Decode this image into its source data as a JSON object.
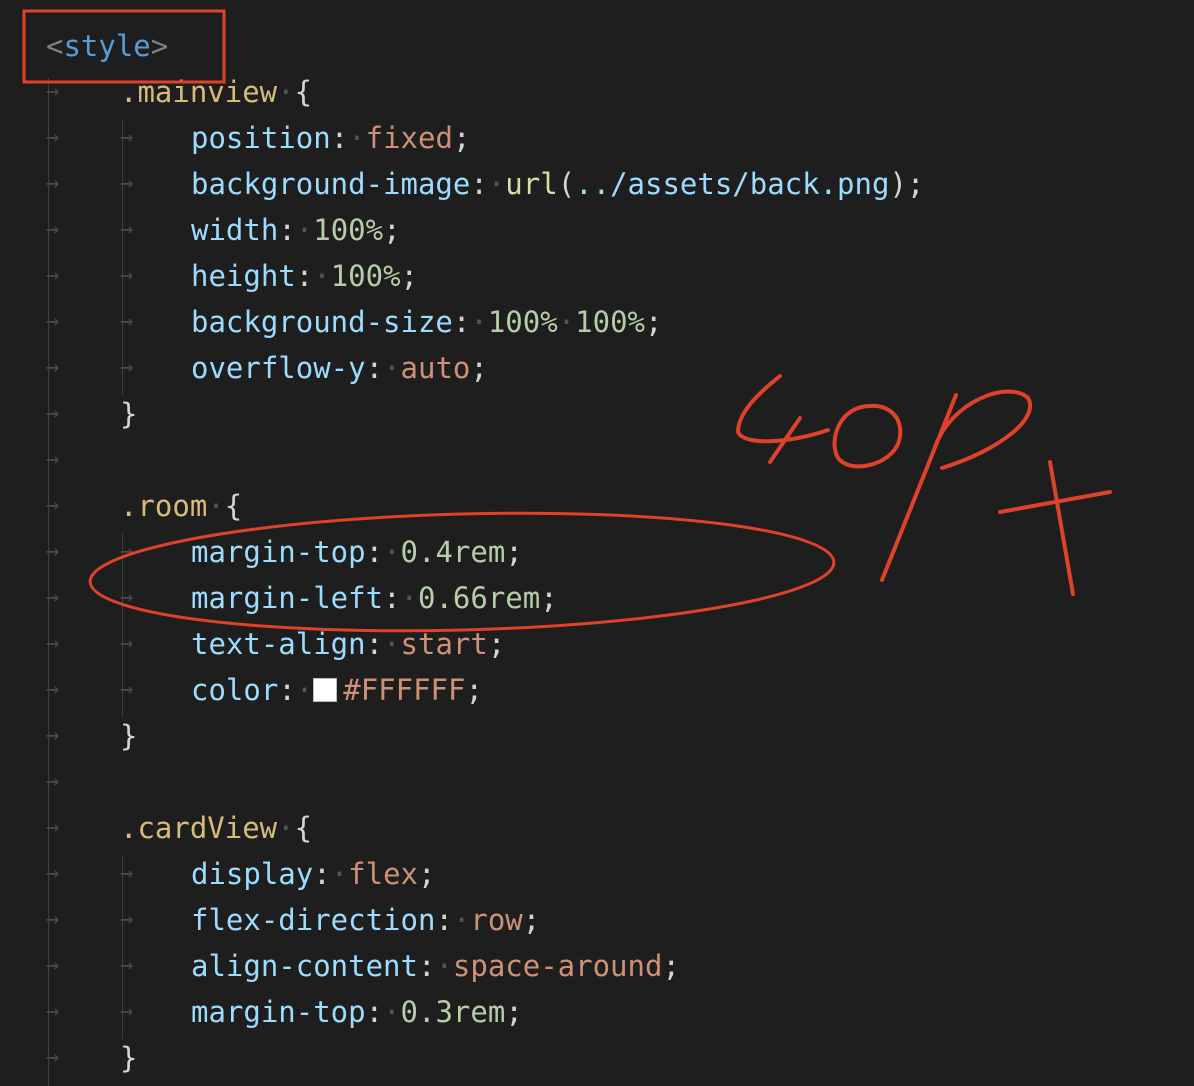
{
  "editor": {
    "theme_colors": {
      "background": "#1e1e1e",
      "tag": "#569cd6",
      "selector": "#d7ba7d",
      "property": "#9cdcfe",
      "keyword_value": "#ce9178",
      "number": "#b5cea8",
      "function": "#dcdcaa",
      "annotation": "#e0412a"
    },
    "lines": [
      {
        "type": "tag",
        "open": "<",
        "name": "style",
        "close": ">"
      },
      {
        "type": "selector",
        "selector": ".mainview",
        "brace": "{"
      },
      {
        "type": "decl",
        "property": "position",
        "colon": ":",
        "parts": [
          {
            "kind": "val",
            "text": "fixed"
          }
        ],
        "semi": ";"
      },
      {
        "type": "decl",
        "property": "background-image",
        "colon": ":",
        "parts": [
          {
            "kind": "fn",
            "text": "url"
          },
          {
            "kind": "plain",
            "text": "("
          },
          {
            "kind": "prop",
            "text": "../assets/back.png"
          },
          {
            "kind": "plain",
            "text": ")"
          }
        ],
        "semi": ";"
      },
      {
        "type": "decl",
        "property": "width",
        "colon": ":",
        "parts": [
          {
            "kind": "num",
            "text": "100%"
          }
        ],
        "semi": ";"
      },
      {
        "type": "decl",
        "property": "height",
        "colon": ":",
        "parts": [
          {
            "kind": "num",
            "text": "100%"
          }
        ],
        "semi": ";"
      },
      {
        "type": "decl",
        "property": "background-size",
        "colon": ":",
        "parts": [
          {
            "kind": "num",
            "text": "100%"
          },
          {
            "kind": "num",
            "text": "100%"
          }
        ],
        "semi": ";"
      },
      {
        "type": "decl",
        "property": "overflow-y",
        "colon": ":",
        "parts": [
          {
            "kind": "val",
            "text": "auto"
          }
        ],
        "semi": ";"
      },
      {
        "type": "close",
        "brace": "}"
      },
      {
        "type": "blank"
      },
      {
        "type": "selector",
        "selector": ".room",
        "brace": "{"
      },
      {
        "type": "decl",
        "property": "margin-top",
        "colon": ":",
        "parts": [
          {
            "kind": "num",
            "text": "0.4rem"
          }
        ],
        "semi": ";"
      },
      {
        "type": "decl",
        "property": "margin-left",
        "colon": ":",
        "parts": [
          {
            "kind": "num",
            "text": "0.66rem"
          }
        ],
        "semi": ";"
      },
      {
        "type": "decl",
        "property": "text-align",
        "colon": ":",
        "parts": [
          {
            "kind": "val",
            "text": "start"
          }
        ],
        "semi": ";"
      },
      {
        "type": "decl",
        "property": "color",
        "colon": ":",
        "parts": [
          {
            "kind": "swatch",
            "color": "#FFFFFF"
          },
          {
            "kind": "val",
            "text": "#FFFFFF"
          }
        ],
        "semi": ";"
      },
      {
        "type": "close",
        "brace": "}"
      },
      {
        "type": "blank"
      },
      {
        "type": "selector",
        "selector": ".cardView",
        "brace": "{"
      },
      {
        "type": "decl",
        "property": "display",
        "colon": ":",
        "parts": [
          {
            "kind": "val",
            "text": "flex"
          }
        ],
        "semi": ";"
      },
      {
        "type": "decl",
        "property": "flex-direction",
        "colon": ":",
        "parts": [
          {
            "kind": "val",
            "text": "row"
          }
        ],
        "semi": ";"
      },
      {
        "type": "decl",
        "property": "align-content",
        "colon": ":",
        "parts": [
          {
            "kind": "val",
            "text": "space-around"
          }
        ],
        "semi": ";"
      },
      {
        "type": "decl",
        "property": "margin-top",
        "colon": ":",
        "parts": [
          {
            "kind": "num",
            "text": "0.3rem"
          }
        ],
        "semi": ";"
      },
      {
        "type": "close",
        "brace": "}"
      }
    ]
  },
  "annotations": {
    "handwritten_note": "40px",
    "boxed_element": "<style>",
    "circled_properties": [
      "margin-top",
      "margin-left"
    ]
  }
}
